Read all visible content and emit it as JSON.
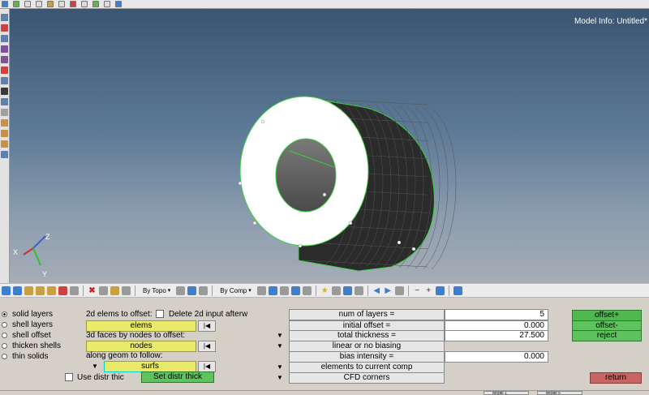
{
  "viewport": {
    "model_info": "Model Info: Untitled*",
    "axis_labels": {
      "x": "X",
      "y": "Y",
      "z": "Z"
    },
    "colors": {
      "mesh_edge": "#39d13a",
      "shell": "#2b2b2b",
      "face": "#ffffff",
      "hole": "#6c6c6c"
    }
  },
  "toolbar": {
    "by_topo": "By Topo",
    "by_comp": "By Comp"
  },
  "options": [
    {
      "label": "solid layers",
      "selected": true
    },
    {
      "label": "shell layers",
      "selected": false
    },
    {
      "label": "shell offset",
      "selected": false
    },
    {
      "label": "thicken shells",
      "selected": false
    },
    {
      "label": "thin solids",
      "selected": false
    }
  ],
  "offset_form": {
    "elems_label": "2d elems to offset:",
    "delete_2d_label": "Delete 2d input afterw",
    "elems_btn": "elems",
    "nodes_label": "3d faces by nodes to offset:",
    "nodes_btn": "nodes",
    "geom_label": "along geom to follow:",
    "surfs_btn": "surfs",
    "use_distr_label": "Use distr thic",
    "set_distr_btn": "Set distr thick"
  },
  "params": {
    "num_layers_label": "num of layers  =",
    "num_layers_value": "5",
    "initial_offset_label": "initial offset =",
    "initial_offset_value": "0.000",
    "total_thickness_label": "total thickness =",
    "total_thickness_value": "27.500",
    "biasing_label": "linear or no biasing",
    "bias_intensity_label": "bias intensity =",
    "bias_intensity_value": "0.000",
    "elements_to_comp_label": "elements to current comp",
    "cfd_corners_label": "CFD corners"
  },
  "actions": {
    "offset_plus": "offset+",
    "offset_minus": "offset-",
    "reject": "reject",
    "return": "return"
  },
  "status_tabs": [
    "Model 1",
    "Model 5"
  ]
}
